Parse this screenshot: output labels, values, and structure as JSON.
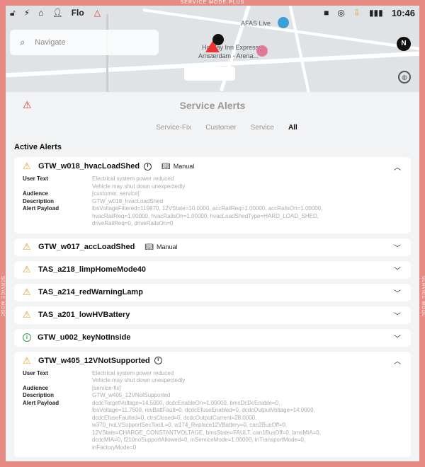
{
  "status": {
    "name": "Flo",
    "mode_label": "SERVICE MODE PLUS",
    "side_label": "SERVICE MODE",
    "time": "10:46"
  },
  "map": {
    "search_placeholder": "Navigate",
    "labels": [
      {
        "text": "AFAS Live"
      },
      {
        "text": "Holiday Inn Express"
      },
      {
        "text": "Amsterdam - Arena..."
      }
    ],
    "compass": "N"
  },
  "panel": {
    "title": "Service Alerts",
    "tabs": [
      "Service-Fix",
      "Customer",
      "Service",
      "All"
    ],
    "active_tab": "All",
    "section_title": "Active Alerts",
    "manual_label": "Manual"
  },
  "alerts": [
    {
      "name": "GTW_w018_hvacLoadShed",
      "severity": "warning",
      "help": true,
      "manual": true,
      "expanded": true,
      "user_text": [
        "Electrical system power reduced",
        "Vehicle may shut down unexpectedly"
      ],
      "audience": "[customer, service]",
      "description": "GTW_w018_hvacLoadShed",
      "payload": [
        "lbsVoltageFiltered=11987​0, 12VState=10.0000, accRailReq=1.00000, accRailsOn=1.00000,",
        "hvacRailReq=1.00000, hvacRailsOn=1.00000, hvacLoadShedType=HARD_LOAD_SHED,",
        "driveRailReq=0, driveRailsOn=0"
      ]
    },
    {
      "name": "GTW_w017_accLoadShed",
      "severity": "warning",
      "help": false,
      "manual": true,
      "expanded": false
    },
    {
      "name": "TAS_a218_limpHomeMode40",
      "severity": "warning",
      "help": false,
      "manual": false,
      "expanded": false
    },
    {
      "name": "TAS_a214_redWarningLamp",
      "severity": "warning",
      "help": false,
      "manual": false,
      "expanded": false
    },
    {
      "name": "TAS_a201_lowHVBattery",
      "severity": "warning",
      "help": false,
      "manual": false,
      "expanded": false
    },
    {
      "name": "GTW_u002_keyNotInside",
      "severity": "info",
      "help": false,
      "manual": false,
      "expanded": false
    },
    {
      "name": "GTW_w405_12VNotSupported",
      "severity": "warning",
      "help": true,
      "manual": false,
      "expanded": true,
      "user_text": [
        "Electrical system power reduced",
        "Vehicle may shut down unexpectedly"
      ],
      "audience": "[service-fix]",
      "description": "GTW_w405_12VNotSupported",
      "payload": [
        "dcdcTargetVoltage=14.5000, dcdcEnableOn=1.00000, bmsDcDcEnable=0,",
        "lbsVoltage=11.7500, revBattFault=0, dcdcEfuseEnabled=0, dcdcOutputVoltage=14.0000,",
        "dcdcEfuseFaulted=0, ctrsClosed=0, dcdcOutputCurrent=28.0000,",
        "w370_noLVSupportSecToolL=0, w174_Replace12VBattery=0, can2BusOff=0,",
        "12VState=CHARGE_CONSTANTVOLTAGE, bmsState=FAULT, can1BusOff=0, bmsMIA=0,",
        "dcdcMIA=0, f210noSupportAllowed=0, inServiceMode=1.00000, inTransportMode=0,",
        "inFactoryMode=0"
      ]
    }
  ],
  "field_labels": {
    "user_text": "User Text",
    "audience": "Audience",
    "description": "Description",
    "payload": "Alert Payload"
  }
}
